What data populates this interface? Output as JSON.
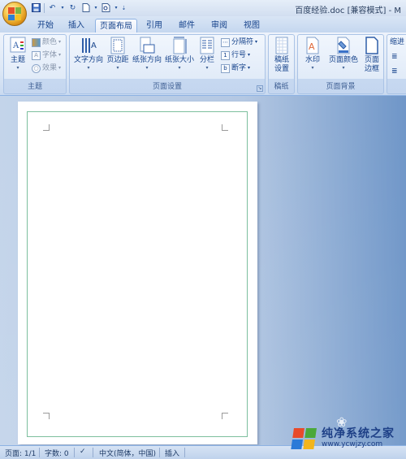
{
  "title_bar": {
    "document_title": "百度经验.doc [兼容模式] - M",
    "quick_access": [
      "save-icon",
      "undo-icon",
      "redo-icon",
      "new-doc-icon",
      "print-preview-icon",
      "customize-icon"
    ]
  },
  "tabs": [
    {
      "label": "开始",
      "active": false
    },
    {
      "label": "插入",
      "active": false
    },
    {
      "label": "页面布局",
      "active": true
    },
    {
      "label": "引用",
      "active": false
    },
    {
      "label": "邮件",
      "active": false
    },
    {
      "label": "审阅",
      "active": false
    },
    {
      "label": "视图",
      "active": false
    }
  ],
  "ribbon": {
    "themes": {
      "label": "主题",
      "theme_btn": "主题",
      "colors": "颜色",
      "fonts": "字体",
      "effects": "效果"
    },
    "page_setup": {
      "label": "页面设置",
      "text_direction": "文字方向",
      "margins": "页边距",
      "orientation": "纸张方向",
      "size": "纸张大小",
      "columns": "分栏",
      "breaks": "分隔符",
      "line_numbers": "行号",
      "hyphenation": "断字"
    },
    "manuscript": {
      "label": "稿纸",
      "settings_line1": "稿纸",
      "settings_line2": "设置"
    },
    "page_background": {
      "label": "页面背景",
      "watermark": "水印",
      "page_color": "页面颜色",
      "page_border_line1": "页面",
      "page_border_line2": "边框"
    },
    "partial_group": {
      "label": "缩进"
    }
  },
  "status_bar": {
    "page": "页面: 1/1",
    "words": "字数: 0",
    "language": "中文(简体，中国)",
    "mode": "插入"
  },
  "watermark_logo": {
    "main": "纯净系统之家",
    "sub": "www.ycwjzy.com"
  },
  "colors": {
    "accent": "#15428b",
    "ribbon_bg": "#dde8f6",
    "workspace": "#b4c8e3",
    "text_border": "#7dbf9e"
  }
}
